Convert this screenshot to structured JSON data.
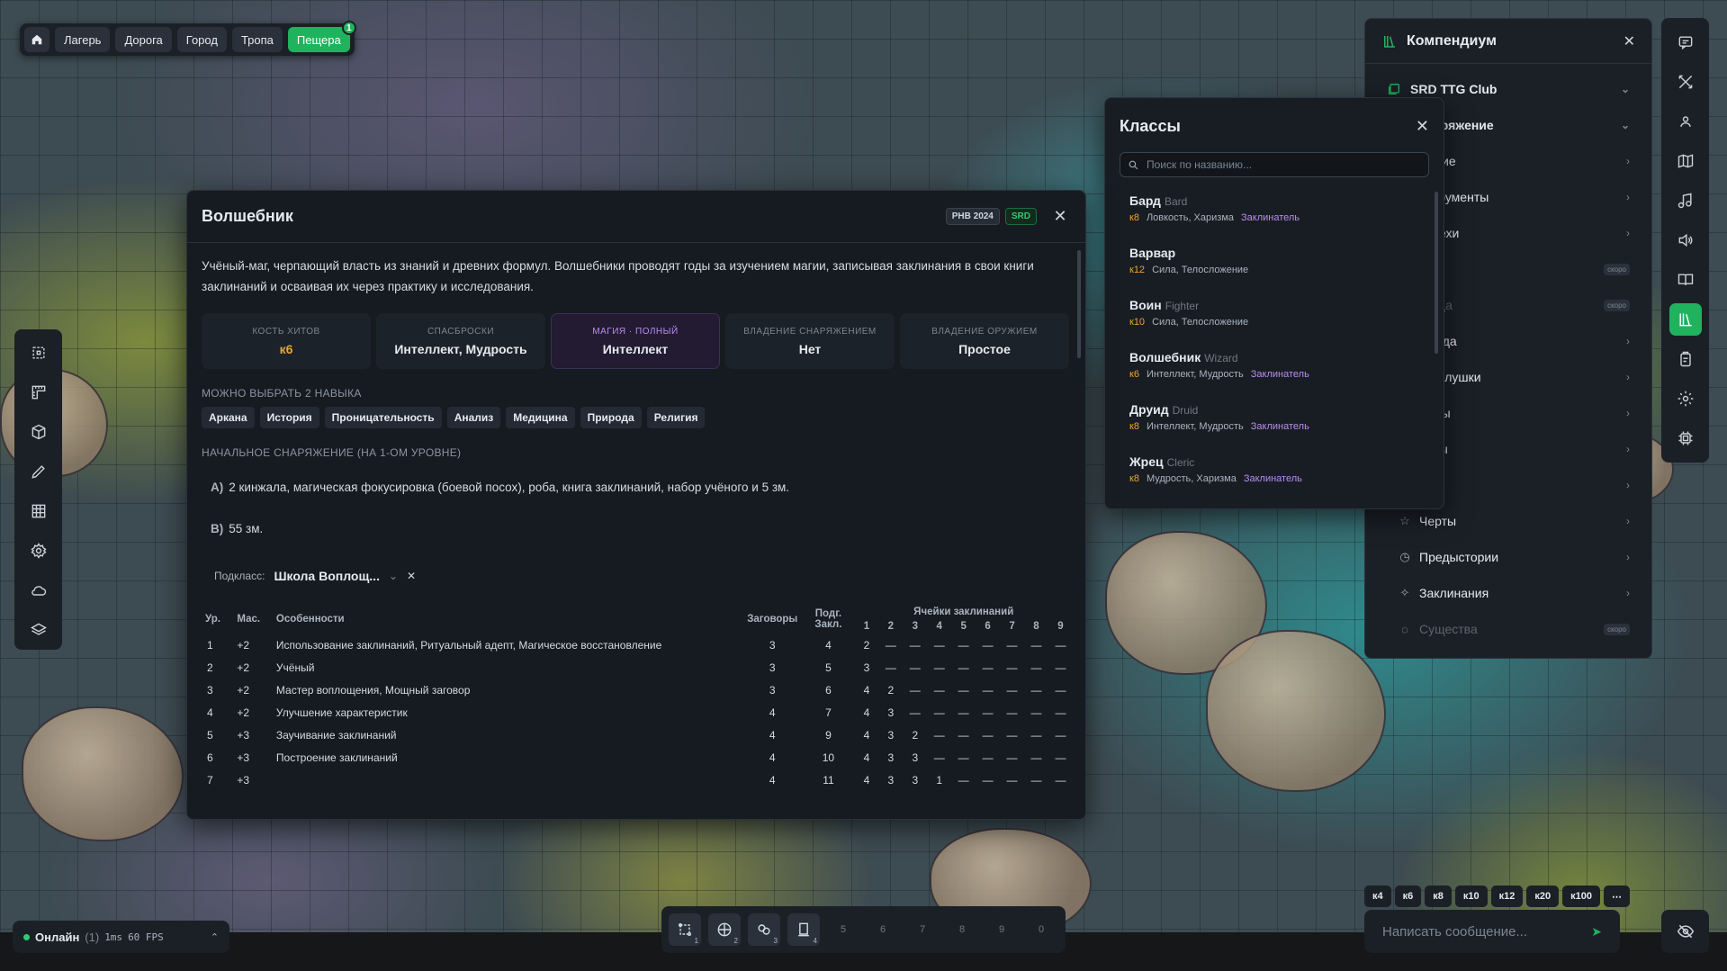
{
  "topnav": {
    "tabs": [
      {
        "label": "Лагерь"
      },
      {
        "label": "Дорога"
      },
      {
        "label": "Город"
      },
      {
        "label": "Тропа"
      },
      {
        "label": "Пещера",
        "badge": "1",
        "active": true
      }
    ]
  },
  "wizard": {
    "title": "Волшебник",
    "tag_book": "PHB 2024",
    "tag_srd": "SRD",
    "description": "Учёный-маг, черпающий власть из знаний и древних формул. Волшебники проводят годы за изучением магии, записывая заклинания в свои книги заклинаний и осваивая их через практику и исследования.",
    "stats": [
      {
        "label": "КОСТЬ ХИТОВ",
        "value": "к6"
      },
      {
        "label": "СПАСБРОСКИ",
        "value": "Интеллект, Мудрость"
      },
      {
        "label": "МАГИЯ · ПОЛНЫЙ",
        "value": "Интеллект"
      },
      {
        "label": "ВЛАДЕНИЕ СНАРЯЖЕНИЕМ",
        "value": "Нет"
      },
      {
        "label": "ВЛАДЕНИЕ ОРУЖИЕМ",
        "value": "Простое"
      }
    ],
    "skills_title": "МОЖНО ВЫБРАТЬ 2 НАВЫКА",
    "skills": [
      "Аркана",
      "История",
      "Проницательность",
      "Анализ",
      "Медицина",
      "Природа",
      "Религия"
    ],
    "equipment_title": "НАЧАЛЬНОЕ СНАРЯЖЕНИЕ (НА 1-ОМ УРОВНЕ)",
    "equipment": [
      {
        "letter": "A)",
        "text": "2 кинжала, магическая фокусировка (боевой посох), роба, книга заклинаний, набор учёного и 5 зм."
      },
      {
        "letter": "B)",
        "text": "55 зм."
      }
    ],
    "subclass_label": "Подкласс:",
    "subclass_value": "Школа Воплощ...",
    "table": {
      "headers": {
        "level": "Ур.",
        "mastery": "Мас.",
        "features": "Особенности",
        "cantrips": "Заговоры",
        "prepared": "Подг. Закл.",
        "slots": "Ячейки заклинаний"
      },
      "slot_levels": [
        "1",
        "2",
        "3",
        "4",
        "5",
        "6",
        "7",
        "8",
        "9"
      ],
      "rows": [
        {
          "level": "1",
          "mastery": "+2",
          "features": "Использование заклинаний, Ритуальный адепт, Магическое восстановление",
          "green": false,
          "cantrips": "3",
          "prepared": "4",
          "slots": [
            "2",
            "—",
            "—",
            "—",
            "—",
            "—",
            "—",
            "—",
            "—"
          ]
        },
        {
          "level": "2",
          "mastery": "+2",
          "features": "Учёный",
          "green": false,
          "cantrips": "3",
          "prepared": "5",
          "slots": [
            "3",
            "—",
            "—",
            "—",
            "—",
            "—",
            "—",
            "—",
            "—"
          ]
        },
        {
          "level": "3",
          "mastery": "+2",
          "features": "Мастер воплощения, Мощный заговор",
          "green": true,
          "cantrips": "3",
          "prepared": "6",
          "slots": [
            "4",
            "2",
            "—",
            "—",
            "—",
            "—",
            "—",
            "—",
            "—"
          ]
        },
        {
          "level": "4",
          "mastery": "+2",
          "features": "Улучшение характеристик",
          "green": false,
          "cantrips": "4",
          "prepared": "7",
          "slots": [
            "4",
            "3",
            "—",
            "—",
            "—",
            "—",
            "—",
            "—",
            "—"
          ]
        },
        {
          "level": "5",
          "mastery": "+3",
          "features": "Заучивание заклинаний",
          "green": false,
          "cantrips": "4",
          "prepared": "9",
          "slots": [
            "4",
            "3",
            "2",
            "—",
            "—",
            "—",
            "—",
            "—",
            "—"
          ]
        },
        {
          "level": "6",
          "mastery": "+3",
          "features": "Построение заклинаний",
          "green": true,
          "cantrips": "4",
          "prepared": "10",
          "slots": [
            "4",
            "3",
            "3",
            "—",
            "—",
            "—",
            "—",
            "—",
            "—"
          ]
        },
        {
          "level": "7",
          "mastery": "+3",
          "features": "",
          "green": false,
          "cantrips": "4",
          "prepared": "11",
          "slots": [
            "4",
            "3",
            "3",
            "1",
            "—",
            "—",
            "—",
            "—",
            "—"
          ]
        }
      ]
    }
  },
  "classes": {
    "title": "Классы",
    "search_placeholder": "Поиск по названию...",
    "items": [
      {
        "name": "Бард",
        "en": "Bard",
        "die": "к8",
        "stats": "Ловкость, Харизма",
        "caster": "Заклинатель"
      },
      {
        "name": "Варвар",
        "en": "",
        "die": "к12",
        "stats": "Сила, Телосложение",
        "caster": ""
      },
      {
        "name": "Воин",
        "en": "Fighter",
        "die": "к10",
        "stats": "Сила, Телосложение",
        "caster": ""
      },
      {
        "name": "Волшебник",
        "en": "Wizard",
        "die": "к6",
        "stats": "Интеллект, Мудрость",
        "caster": "Заклинатель"
      },
      {
        "name": "Друид",
        "en": "Druid",
        "die": "к8",
        "stats": "Интеллект, Мудрость",
        "caster": "Заклинатель"
      },
      {
        "name": "Жрец",
        "en": "Cleric",
        "die": "к8",
        "stats": "Мудрость, Харизма",
        "caster": "Заклинатель"
      }
    ]
  },
  "compendium": {
    "title": "Компендиум",
    "source": "SRD TTG Club",
    "section": "аряжение",
    "items": [
      {
        "label": "Оружие",
        "dim": false,
        "soon": ""
      },
      {
        "label": "Инструменты",
        "dim": false,
        "soon": ""
      },
      {
        "label": "Доспехи",
        "dim": false,
        "soon": ""
      },
      {
        "label": "Зелья",
        "dim": true,
        "soon": "скоро"
      },
      {
        "label": "Кольца",
        "dim": true,
        "soon": "скоро"
      },
      {
        "label": "Одежда",
        "dim": false,
        "soon": ""
      },
      {
        "label": "Безделушки",
        "dim": false,
        "soon": ""
      },
      {
        "label": "Жезлы",
        "dim": false,
        "soon": ""
      }
    ],
    "lower": [
      {
        "label": "ассы",
        "icon": "",
        "dim": false,
        "soon": ""
      },
      {
        "label": "ды",
        "icon": "",
        "dim": false,
        "soon": ""
      },
      {
        "label": "Черты",
        "icon": "☆",
        "dim": false,
        "soon": ""
      },
      {
        "label": "Предыстории",
        "icon": "◷",
        "dim": false,
        "soon": ""
      },
      {
        "label": "Заклинания",
        "icon": "✧",
        "dim": false,
        "soon": ""
      },
      {
        "label": "Существа",
        "icon": "◌",
        "dim": true,
        "soon": "скоро"
      }
    ]
  },
  "dice": [
    "к4",
    "к6",
    "к8",
    "к10",
    "к12",
    "к20",
    "к100",
    "⋯"
  ],
  "chat": {
    "placeholder": "Написать сообщение..."
  },
  "hotbar": {
    "filled": [
      {
        "num": "1"
      },
      {
        "num": "2"
      },
      {
        "num": "3"
      },
      {
        "num": "4"
      }
    ],
    "empty": [
      "5",
      "6",
      "7",
      "8",
      "9",
      "0"
    ]
  },
  "status": {
    "online": "Онлайн",
    "count": "(1)",
    "ping": "1ms",
    "fps": "60 FPS"
  },
  "colors": {
    "accent": "#1fb35e",
    "die": "#e7a43a",
    "caster": "#b98cf0",
    "feature": "#2ecc71"
  }
}
